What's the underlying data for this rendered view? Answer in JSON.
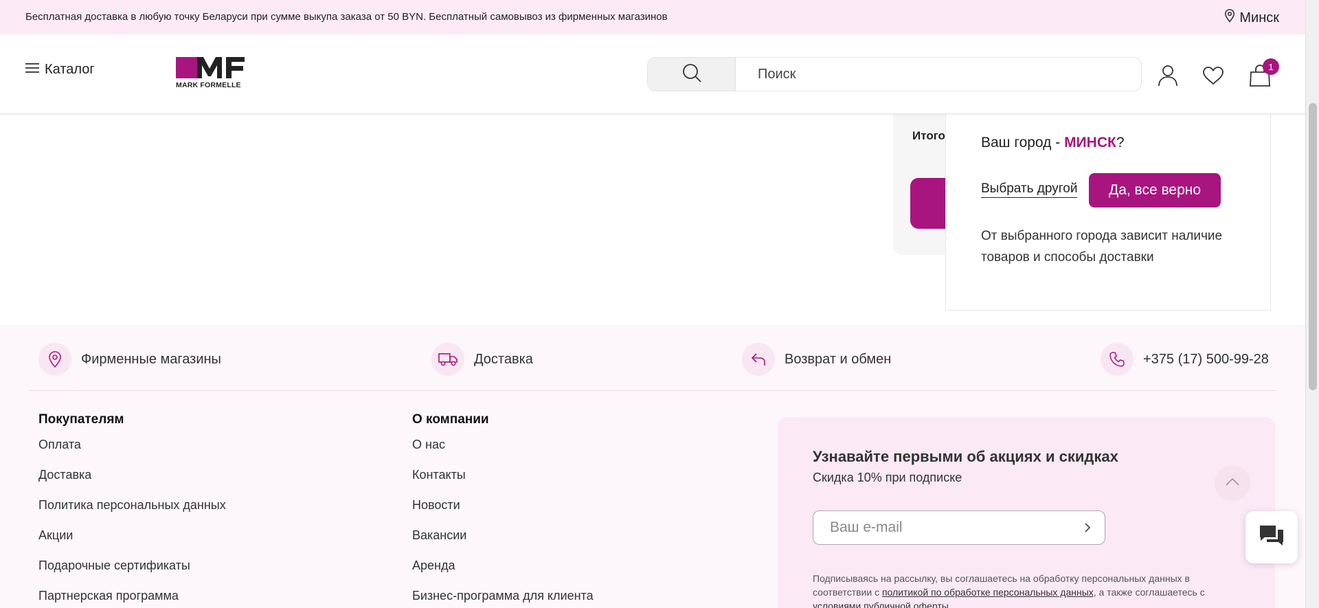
{
  "topbar": {
    "notice": "Бесплатная доставка в любую точку Беларуси при сумме выкупа заказа от 50 BYN. Бесплатный самовывоз из фирменных магазинов",
    "city": "Минск"
  },
  "header": {
    "catalog_label": "Каталог",
    "logo_text": "MARK FORMELLE",
    "search_placeholder": "Поиск",
    "cart_count": "1"
  },
  "summary": {
    "total_label": "Итого"
  },
  "city_popup": {
    "question_prefix": "Ваш город - ",
    "city": "МИНСК",
    "question_suffix": "?",
    "choose_other": "Выбрать другой",
    "confirm": "Да, все верно",
    "note": "От выбранного города зависит наличие товаров и способы доставки"
  },
  "features": [
    {
      "label": "Фирменные магазины",
      "icon": "location-pin-icon"
    },
    {
      "label": "Доставка",
      "icon": "truck-icon"
    },
    {
      "label": "Возврат и обмен",
      "icon": "return-arrow-icon"
    },
    {
      "label": "+375 (17) 500-99-28",
      "icon": "phone-icon"
    }
  ],
  "buyers": {
    "title": "Покупателям",
    "links": [
      "Оплата",
      "Доставка",
      "Политика персональных данных",
      "Акции",
      "Подарочные сертификаты",
      "Партнерская программа"
    ]
  },
  "company": {
    "title": "О компании",
    "links": [
      "О нас",
      "Контакты",
      "Новости",
      "Вакансии",
      "Аренда",
      "Бизнес-программа для клиента"
    ]
  },
  "subscribe": {
    "title": "Узнавайте первыми об акциях и скидках",
    "subtitle": "Скидка 10% при подписке",
    "email_placeholder": "Ваш e-mail",
    "legal_1": "Подписываясь на рассылку, вы соглашаетесь на обработку персональных данных в соответствии с ",
    "legal_link_1": "политикой по обработке персональных данных",
    "legal_2": ", а также соглашаетесь с ",
    "legal_link_2": "условиями публичной оферты"
  },
  "colors": {
    "brand": "#a8157f",
    "topbar_bg": "#fcebf7",
    "footer_bg": "#fdf6fb"
  }
}
